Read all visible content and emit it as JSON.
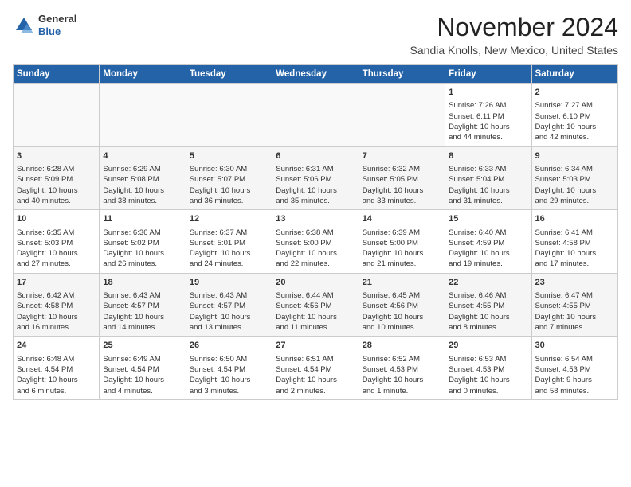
{
  "header": {
    "logo_line1": "General",
    "logo_line2": "Blue",
    "month_year": "November 2024",
    "location": "Sandia Knolls, New Mexico, United States"
  },
  "weekdays": [
    "Sunday",
    "Monday",
    "Tuesday",
    "Wednesday",
    "Thursday",
    "Friday",
    "Saturday"
  ],
  "weeks": [
    [
      {
        "day": "",
        "info": ""
      },
      {
        "day": "",
        "info": ""
      },
      {
        "day": "",
        "info": ""
      },
      {
        "day": "",
        "info": ""
      },
      {
        "day": "",
        "info": ""
      },
      {
        "day": "1",
        "info": "Sunrise: 7:26 AM\nSunset: 6:11 PM\nDaylight: 10 hours\nand 44 minutes."
      },
      {
        "day": "2",
        "info": "Sunrise: 7:27 AM\nSunset: 6:10 PM\nDaylight: 10 hours\nand 42 minutes."
      }
    ],
    [
      {
        "day": "3",
        "info": "Sunrise: 6:28 AM\nSunset: 5:09 PM\nDaylight: 10 hours\nand 40 minutes."
      },
      {
        "day": "4",
        "info": "Sunrise: 6:29 AM\nSunset: 5:08 PM\nDaylight: 10 hours\nand 38 minutes."
      },
      {
        "day": "5",
        "info": "Sunrise: 6:30 AM\nSunset: 5:07 PM\nDaylight: 10 hours\nand 36 minutes."
      },
      {
        "day": "6",
        "info": "Sunrise: 6:31 AM\nSunset: 5:06 PM\nDaylight: 10 hours\nand 35 minutes."
      },
      {
        "day": "7",
        "info": "Sunrise: 6:32 AM\nSunset: 5:05 PM\nDaylight: 10 hours\nand 33 minutes."
      },
      {
        "day": "8",
        "info": "Sunrise: 6:33 AM\nSunset: 5:04 PM\nDaylight: 10 hours\nand 31 minutes."
      },
      {
        "day": "9",
        "info": "Sunrise: 6:34 AM\nSunset: 5:03 PM\nDaylight: 10 hours\nand 29 minutes."
      }
    ],
    [
      {
        "day": "10",
        "info": "Sunrise: 6:35 AM\nSunset: 5:03 PM\nDaylight: 10 hours\nand 27 minutes."
      },
      {
        "day": "11",
        "info": "Sunrise: 6:36 AM\nSunset: 5:02 PM\nDaylight: 10 hours\nand 26 minutes."
      },
      {
        "day": "12",
        "info": "Sunrise: 6:37 AM\nSunset: 5:01 PM\nDaylight: 10 hours\nand 24 minutes."
      },
      {
        "day": "13",
        "info": "Sunrise: 6:38 AM\nSunset: 5:00 PM\nDaylight: 10 hours\nand 22 minutes."
      },
      {
        "day": "14",
        "info": "Sunrise: 6:39 AM\nSunset: 5:00 PM\nDaylight: 10 hours\nand 21 minutes."
      },
      {
        "day": "15",
        "info": "Sunrise: 6:40 AM\nSunset: 4:59 PM\nDaylight: 10 hours\nand 19 minutes."
      },
      {
        "day": "16",
        "info": "Sunrise: 6:41 AM\nSunset: 4:58 PM\nDaylight: 10 hours\nand 17 minutes."
      }
    ],
    [
      {
        "day": "17",
        "info": "Sunrise: 6:42 AM\nSunset: 4:58 PM\nDaylight: 10 hours\nand 16 minutes."
      },
      {
        "day": "18",
        "info": "Sunrise: 6:43 AM\nSunset: 4:57 PM\nDaylight: 10 hours\nand 14 minutes."
      },
      {
        "day": "19",
        "info": "Sunrise: 6:43 AM\nSunset: 4:57 PM\nDaylight: 10 hours\nand 13 minutes."
      },
      {
        "day": "20",
        "info": "Sunrise: 6:44 AM\nSunset: 4:56 PM\nDaylight: 10 hours\nand 11 minutes."
      },
      {
        "day": "21",
        "info": "Sunrise: 6:45 AM\nSunset: 4:56 PM\nDaylight: 10 hours\nand 10 minutes."
      },
      {
        "day": "22",
        "info": "Sunrise: 6:46 AM\nSunset: 4:55 PM\nDaylight: 10 hours\nand 8 minutes."
      },
      {
        "day": "23",
        "info": "Sunrise: 6:47 AM\nSunset: 4:55 PM\nDaylight: 10 hours\nand 7 minutes."
      }
    ],
    [
      {
        "day": "24",
        "info": "Sunrise: 6:48 AM\nSunset: 4:54 PM\nDaylight: 10 hours\nand 6 minutes."
      },
      {
        "day": "25",
        "info": "Sunrise: 6:49 AM\nSunset: 4:54 PM\nDaylight: 10 hours\nand 4 minutes."
      },
      {
        "day": "26",
        "info": "Sunrise: 6:50 AM\nSunset: 4:54 PM\nDaylight: 10 hours\nand 3 minutes."
      },
      {
        "day": "27",
        "info": "Sunrise: 6:51 AM\nSunset: 4:54 PM\nDaylight: 10 hours\nand 2 minutes."
      },
      {
        "day": "28",
        "info": "Sunrise: 6:52 AM\nSunset: 4:53 PM\nDaylight: 10 hours\nand 1 minute."
      },
      {
        "day": "29",
        "info": "Sunrise: 6:53 AM\nSunset: 4:53 PM\nDaylight: 10 hours\nand 0 minutes."
      },
      {
        "day": "30",
        "info": "Sunrise: 6:54 AM\nSunset: 4:53 PM\nDaylight: 9 hours\nand 58 minutes."
      }
    ]
  ]
}
